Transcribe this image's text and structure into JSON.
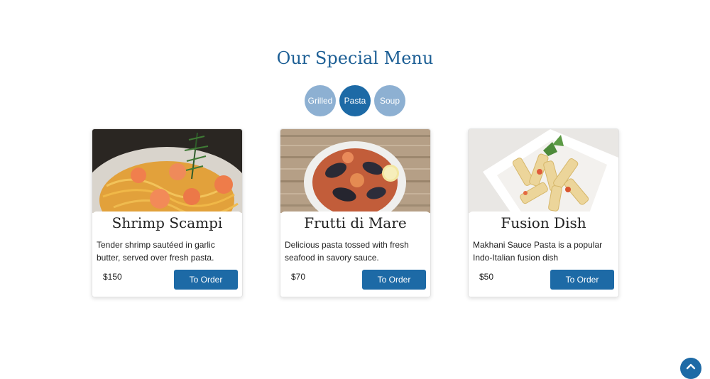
{
  "section": {
    "title": "Our Special Menu"
  },
  "tabs": [
    {
      "label": "Grilled",
      "active": false
    },
    {
      "label": "Pasta",
      "active": true
    },
    {
      "label": "Soup",
      "active": false
    }
  ],
  "cards": [
    {
      "name": "Shrimp Scampi",
      "description": "Tender shrimp sautéed in garlic butter, served over fresh pasta.",
      "price": "$150",
      "order_label": "To Order"
    },
    {
      "name": "Frutti di Mare",
      "description": "Delicious pasta tossed with fresh seafood in savory sauce.",
      "price": "$70",
      "order_label": "To Order"
    },
    {
      "name": "Fusion Dish",
      "description": "Makhani Sauce Pasta is a popular Indo-Italian fusion dish",
      "price": "$50",
      "order_label": "To Order"
    }
  ],
  "colors": {
    "accent": "#1d6aa6",
    "title": "#1d5f95",
    "tab_inactive": "#8db0d2"
  },
  "icons": {
    "scroll_top": "chevron-up-icon"
  }
}
